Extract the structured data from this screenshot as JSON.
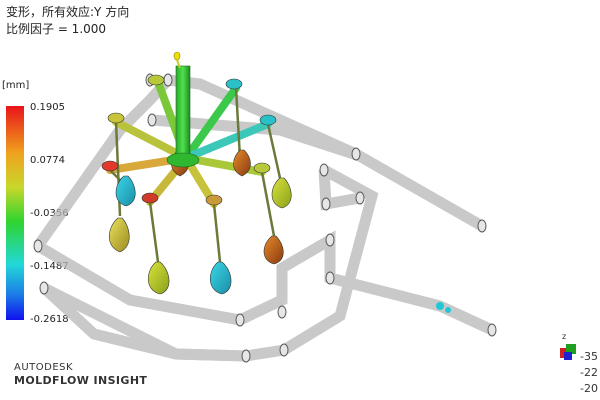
{
  "header": {
    "title_line1": "变形，所有效应:Y 方向",
    "title_line2": "比例因子 = 1.000"
  },
  "legend": {
    "unit": "[mm]",
    "values": [
      "0.1905",
      "0.0774",
      "-0.0356",
      "-0.1487",
      "-0.2618"
    ],
    "colors": {
      "max": "#e8141a",
      "mid": "#2fd42f",
      "min": "#1010ee"
    }
  },
  "brand": {
    "line1": "AUTODESK",
    "line2": "MOLDFLOW INSIGHT"
  },
  "triad": {
    "axis_label": "z",
    "values": [
      "-35",
      "-22",
      "-20"
    ]
  },
  "icons": [
    "model-view",
    "orientation-triad"
  ]
}
